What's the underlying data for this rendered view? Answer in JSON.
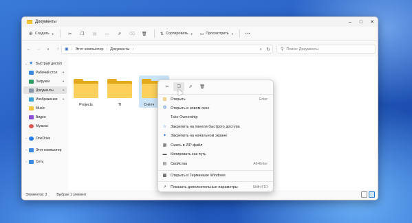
{
  "window": {
    "title": "Документы"
  },
  "toolbar": {
    "new_label": "Создать",
    "sort_label": "Сортировать",
    "view_label": "Просмотреть",
    "more_label": "···"
  },
  "address": {
    "crumbs": [
      "Этот компьютер",
      "Документы"
    ],
    "search_placeholder": "Поиск: Документы"
  },
  "sidebar": {
    "items": [
      {
        "label": "Быстрый доступ"
      },
      {
        "label": "Рабочий стол"
      },
      {
        "label": "Загрузки"
      },
      {
        "label": "Документы"
      },
      {
        "label": "Изображения"
      },
      {
        "label": "Music"
      },
      {
        "label": "Видео"
      },
      {
        "label": "Музыка"
      },
      {
        "label": "OneDrive"
      },
      {
        "label": "Этот компьютер"
      },
      {
        "label": "Сеть"
      }
    ]
  },
  "files": [
    {
      "name": "Projects"
    },
    {
      "name": "TI"
    },
    {
      "name": "Счётч"
    }
  ],
  "status": {
    "count": "Элементов: 3",
    "selected": "Выбран 1 элемент"
  },
  "context_menu": {
    "items": [
      {
        "label": "Открыть",
        "shortcut": "Enter"
      },
      {
        "label": "Открыть в новом окне",
        "shortcut": ""
      },
      {
        "label": "Take Ownership",
        "shortcut": ""
      },
      {
        "label": "Закрепить на панели быстрого доступа",
        "shortcut": ""
      },
      {
        "label": "Закрепить на начальном экране",
        "shortcut": ""
      },
      {
        "label": "Сжать в ZIP-файл",
        "shortcut": ""
      },
      {
        "label": "Копировать как путь",
        "shortcut": ""
      },
      {
        "label": "Свойства",
        "shortcut": "Alt+Enter"
      },
      {
        "label": "Открыть в Терминале Windows",
        "shortcut": ""
      },
      {
        "label": "Показать дополнительные параметры",
        "shortcut": "Shift+F10"
      }
    ]
  },
  "colors": {
    "folder": "#fcd05a",
    "selection": "#cce4f7",
    "accent": "#1a6fc9"
  }
}
